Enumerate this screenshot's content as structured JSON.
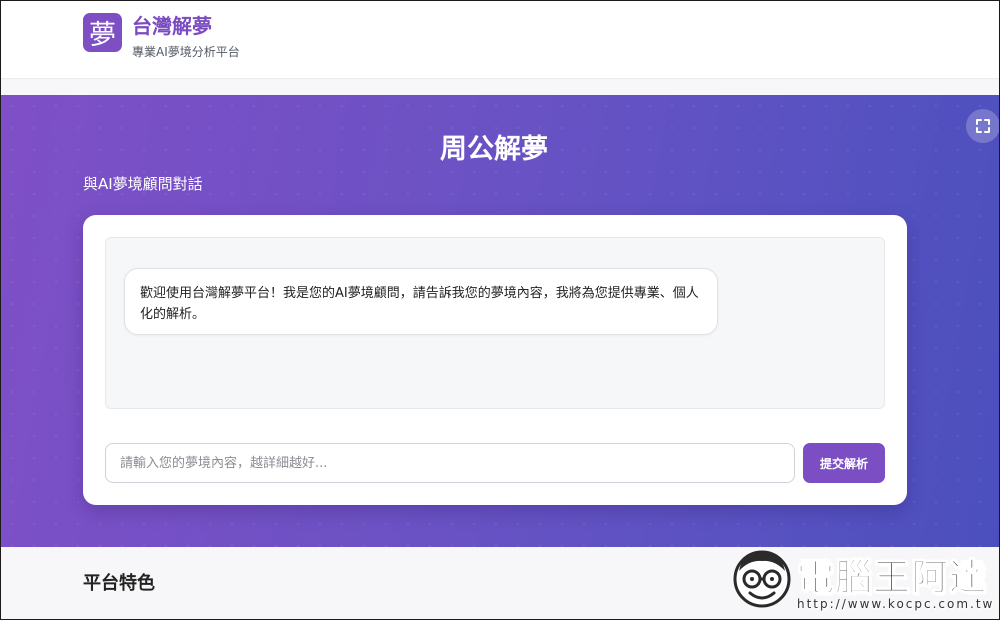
{
  "header": {
    "logo_char": "夢",
    "brand_title": "台灣解夢",
    "brand_subtitle": "專業AI夢境分析平台"
  },
  "hero": {
    "title": "周公解夢",
    "subtitle": "與AI夢境顧問對話",
    "fullscreen_icon": "fullscreen-icon"
  },
  "chat": {
    "welcome_message": "歡迎使用台灣解夢平台！我是您的AI夢境顧問，請告訴我您的夢境內容，我將為您提供專業、個人化的解析。",
    "input_placeholder": "請輸入您的夢境內容，越詳細越好...",
    "input_value": "",
    "submit_label": "提交解析"
  },
  "features": {
    "title": "平台特色"
  },
  "watermark": {
    "name": "電腦王阿達",
    "url": "http://www.kocpc.com.tw"
  },
  "colors": {
    "brand_purple": "#7b4fc3",
    "hero_gradient_start": "#7f4fc7",
    "hero_gradient_end": "#4b4fbd"
  }
}
